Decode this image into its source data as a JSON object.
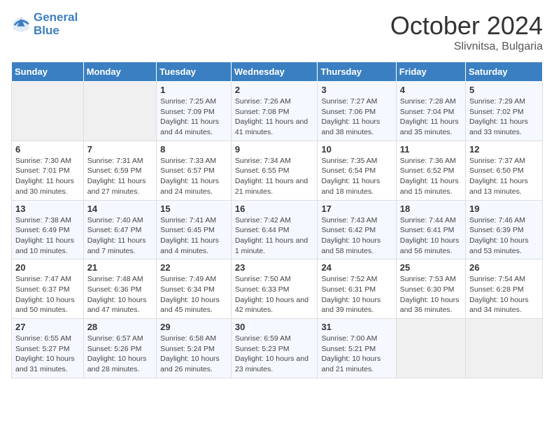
{
  "header": {
    "logo_line1": "General",
    "logo_line2": "Blue",
    "month": "October 2024",
    "location": "Slivnitsa, Bulgaria"
  },
  "days_of_week": [
    "Sunday",
    "Monday",
    "Tuesday",
    "Wednesday",
    "Thursday",
    "Friday",
    "Saturday"
  ],
  "weeks": [
    [
      {
        "day": "",
        "content": ""
      },
      {
        "day": "",
        "content": ""
      },
      {
        "day": "1",
        "content": "Sunrise: 7:25 AM\nSunset: 7:09 PM\nDaylight: 11 hours and 44 minutes."
      },
      {
        "day": "2",
        "content": "Sunrise: 7:26 AM\nSunset: 7:08 PM\nDaylight: 11 hours and 41 minutes."
      },
      {
        "day": "3",
        "content": "Sunrise: 7:27 AM\nSunset: 7:06 PM\nDaylight: 11 hours and 38 minutes."
      },
      {
        "day": "4",
        "content": "Sunrise: 7:28 AM\nSunset: 7:04 PM\nDaylight: 11 hours and 35 minutes."
      },
      {
        "day": "5",
        "content": "Sunrise: 7:29 AM\nSunset: 7:02 PM\nDaylight: 11 hours and 33 minutes."
      }
    ],
    [
      {
        "day": "6",
        "content": "Sunrise: 7:30 AM\nSunset: 7:01 PM\nDaylight: 11 hours and 30 minutes."
      },
      {
        "day": "7",
        "content": "Sunrise: 7:31 AM\nSunset: 6:59 PM\nDaylight: 11 hours and 27 minutes."
      },
      {
        "day": "8",
        "content": "Sunrise: 7:33 AM\nSunset: 6:57 PM\nDaylight: 11 hours and 24 minutes."
      },
      {
        "day": "9",
        "content": "Sunrise: 7:34 AM\nSunset: 6:55 PM\nDaylight: 11 hours and 21 minutes."
      },
      {
        "day": "10",
        "content": "Sunrise: 7:35 AM\nSunset: 6:54 PM\nDaylight: 11 hours and 18 minutes."
      },
      {
        "day": "11",
        "content": "Sunrise: 7:36 AM\nSunset: 6:52 PM\nDaylight: 11 hours and 15 minutes."
      },
      {
        "day": "12",
        "content": "Sunrise: 7:37 AM\nSunset: 6:50 PM\nDaylight: 11 hours and 13 minutes."
      }
    ],
    [
      {
        "day": "13",
        "content": "Sunrise: 7:38 AM\nSunset: 6:49 PM\nDaylight: 11 hours and 10 minutes."
      },
      {
        "day": "14",
        "content": "Sunrise: 7:40 AM\nSunset: 6:47 PM\nDaylight: 11 hours and 7 minutes."
      },
      {
        "day": "15",
        "content": "Sunrise: 7:41 AM\nSunset: 6:45 PM\nDaylight: 11 hours and 4 minutes."
      },
      {
        "day": "16",
        "content": "Sunrise: 7:42 AM\nSunset: 6:44 PM\nDaylight: 11 hours and 1 minute."
      },
      {
        "day": "17",
        "content": "Sunrise: 7:43 AM\nSunset: 6:42 PM\nDaylight: 10 hours and 58 minutes."
      },
      {
        "day": "18",
        "content": "Sunrise: 7:44 AM\nSunset: 6:41 PM\nDaylight: 10 hours and 56 minutes."
      },
      {
        "day": "19",
        "content": "Sunrise: 7:46 AM\nSunset: 6:39 PM\nDaylight: 10 hours and 53 minutes."
      }
    ],
    [
      {
        "day": "20",
        "content": "Sunrise: 7:47 AM\nSunset: 6:37 PM\nDaylight: 10 hours and 50 minutes."
      },
      {
        "day": "21",
        "content": "Sunrise: 7:48 AM\nSunset: 6:36 PM\nDaylight: 10 hours and 47 minutes."
      },
      {
        "day": "22",
        "content": "Sunrise: 7:49 AM\nSunset: 6:34 PM\nDaylight: 10 hours and 45 minutes."
      },
      {
        "day": "23",
        "content": "Sunrise: 7:50 AM\nSunset: 6:33 PM\nDaylight: 10 hours and 42 minutes."
      },
      {
        "day": "24",
        "content": "Sunrise: 7:52 AM\nSunset: 6:31 PM\nDaylight: 10 hours and 39 minutes."
      },
      {
        "day": "25",
        "content": "Sunrise: 7:53 AM\nSunset: 6:30 PM\nDaylight: 10 hours and 36 minutes."
      },
      {
        "day": "26",
        "content": "Sunrise: 7:54 AM\nSunset: 6:28 PM\nDaylight: 10 hours and 34 minutes."
      }
    ],
    [
      {
        "day": "27",
        "content": "Sunrise: 6:55 AM\nSunset: 5:27 PM\nDaylight: 10 hours and 31 minutes."
      },
      {
        "day": "28",
        "content": "Sunrise: 6:57 AM\nSunset: 5:26 PM\nDaylight: 10 hours and 28 minutes."
      },
      {
        "day": "29",
        "content": "Sunrise: 6:58 AM\nSunset: 5:24 PM\nDaylight: 10 hours and 26 minutes."
      },
      {
        "day": "30",
        "content": "Sunrise: 6:59 AM\nSunset: 5:23 PM\nDaylight: 10 hours and 23 minutes."
      },
      {
        "day": "31",
        "content": "Sunrise: 7:00 AM\nSunset: 5:21 PM\nDaylight: 10 hours and 21 minutes."
      },
      {
        "day": "",
        "content": ""
      },
      {
        "day": "",
        "content": ""
      }
    ]
  ]
}
